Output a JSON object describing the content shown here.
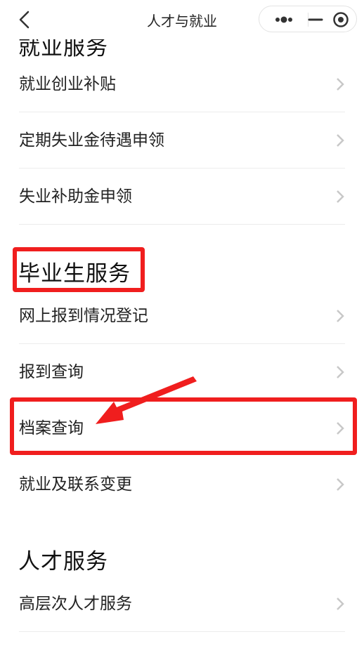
{
  "nav": {
    "title": "人才与就业",
    "icons": [
      "chevron-left-icon",
      "more-dots-icon",
      "minimize-icon",
      "close-target-icon"
    ]
  },
  "sections": [
    {
      "title": "就业服务",
      "items": [
        "就业创业补贴",
        "定期失业金待遇申领",
        "失业补助金申领"
      ]
    },
    {
      "title": "毕业生服务",
      "items": [
        "网上报到情况登记",
        "报到查询",
        "档案查询",
        "就业及联系变更"
      ]
    },
    {
      "title": "人才服务",
      "items": [
        "高层次人才服务"
      ]
    }
  ],
  "colors": {
    "annotation": "#f01e1e",
    "chevron": "#c8c8c8",
    "divider": "#ececec"
  }
}
